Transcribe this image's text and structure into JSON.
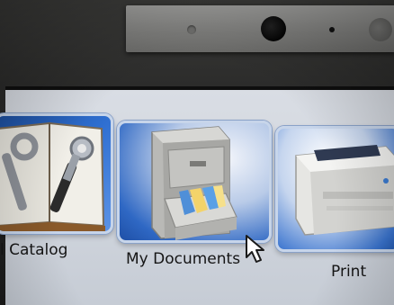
{
  "icons": [
    {
      "label": "l Catalog",
      "icon": "tools-icon"
    },
    {
      "label": "My Documents",
      "icon": "file-cabinet-icon"
    },
    {
      "label": "Print",
      "icon": "printer-icon"
    }
  ],
  "cursor": {
    "icon": "mouse-pointer-icon"
  }
}
